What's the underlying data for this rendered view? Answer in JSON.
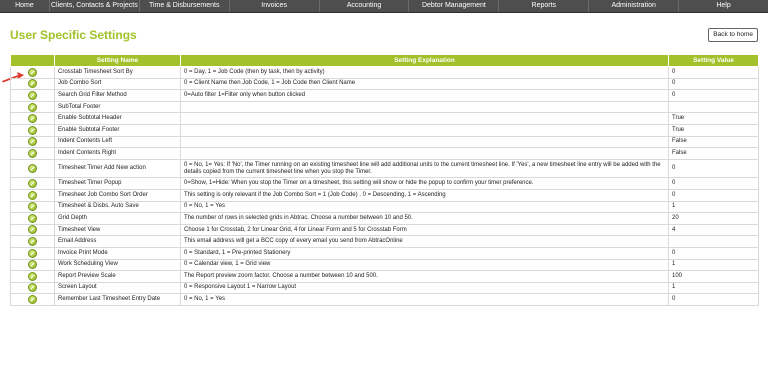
{
  "nav": [
    "Home",
    "Clients, Contacts & Projects",
    "Time & Disbursements",
    "Invoices",
    "Accounting",
    "Debtor Management",
    "Reports",
    "Administration",
    "Help"
  ],
  "page": {
    "title": "User Specific Settings",
    "back_label": "Back to home"
  },
  "table": {
    "headers": [
      "Setting Name",
      "Setting Explanation",
      "Setting Value"
    ],
    "rows": [
      {
        "name": "Crosstab Timesheet Sort By",
        "explanation": "0 = Day, 1 = Job Code (then by task, then by activity)",
        "value": "0"
      },
      {
        "name": "Job Combo Sort",
        "explanation": "0 = Client Name then Job Code, 1 = Job Code then Client Name",
        "value": "0"
      },
      {
        "name": "Search Grid Filter Method",
        "explanation": "0=Auto filter 1=Filter only when button clicked",
        "value": "0"
      },
      {
        "name": "SubTotal Footer",
        "explanation": "",
        "value": ""
      },
      {
        "name": "Enable Subtotal Header",
        "explanation": "",
        "value": "True"
      },
      {
        "name": "Enable Subtotal Footer",
        "explanation": "",
        "value": "True"
      },
      {
        "name": "Indent Contents Left",
        "explanation": "",
        "value": "False"
      },
      {
        "name": "Indent Contents Right",
        "explanation": "",
        "value": "False"
      },
      {
        "name": "Timesheet Timer Add New action",
        "explanation": "0 = No, 1= Yes: If 'No', the Timer running on an existing timesheet line will add additional units to the current timesheet line. If 'Yes', a new timesheet line entry will be added with the details copied from the current timesheet line when you stop the Timer.",
        "value": "0"
      },
      {
        "name": "Timesheet Timer Popup",
        "explanation": "0=Show, 1=Hide: When you stop the Timer on a timesheet, this setting will show or hide the popup to confirm your timer preference.",
        "value": "0"
      },
      {
        "name": "Timesheet Job Combo Sort Order",
        "explanation": "This setting is only relevant if the Job Combo Sort = 1 (Job Code) . 0 = Descending, 1 = Ascending",
        "value": "0"
      },
      {
        "name": "Timesheet & Disbs. Auto Save",
        "explanation": "0 = No, 1 = Yes",
        "value": "1"
      },
      {
        "name": "Grid Depth",
        "explanation": "The number of rows in selected grids in Abtrac. Choose a number between 10 and 50.",
        "value": "20"
      },
      {
        "name": "Timesheet View",
        "explanation": "Choose 1 for Crosstab, 2 for Linear Grid, 4 for Linear Form and 5 for Crosstab Form",
        "value": "4"
      },
      {
        "name": "Email Address",
        "explanation": "This email address will get a BCC copy of every email you send from AbtracOnline",
        "value": ""
      },
      {
        "name": "Invoice Print Mode",
        "explanation": "0 = Standard, 1 = Pre-printed Stationery",
        "value": "0"
      },
      {
        "name": "Work Scheduling View",
        "explanation": "0 = Calendar view, 1 = Grid view",
        "value": "1"
      },
      {
        "name": "Report Preview Scale",
        "explanation": "The Report preview zoom factor. Choose a number between 10 and 500.",
        "value": "100"
      },
      {
        "name": "Screen Layout",
        "explanation": "0 = Responsive Layout 1 = Narrow Layout",
        "value": "1"
      },
      {
        "name": "Remember Last Timesheet Entry Date",
        "explanation": "0 = No, 1 = Yes",
        "value": "0"
      }
    ]
  },
  "icons": {
    "row_action": "edit-icon",
    "pointer": "red-arrow-icon"
  },
  "colors": {
    "accent": "#a3c12a",
    "nav_bg": "#4e4e4e",
    "pointer": "#e03a2f"
  }
}
